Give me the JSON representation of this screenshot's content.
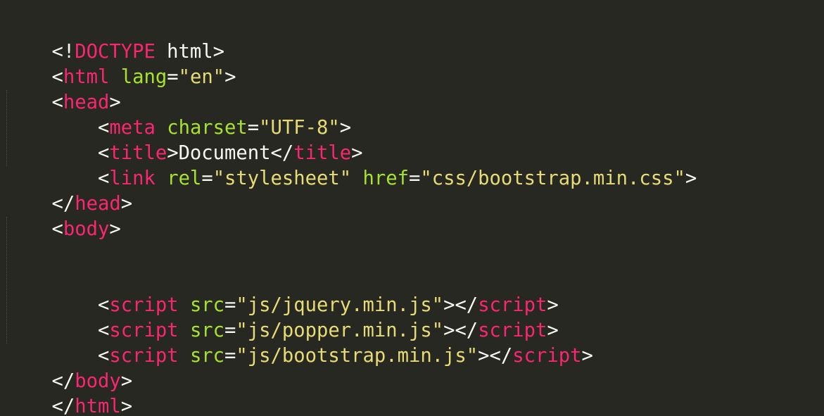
{
  "editor": {
    "language": "html",
    "theme_colors": {
      "background": "#272822",
      "tag": "#f92672",
      "attribute": "#a6e22e",
      "string": "#e6db74",
      "text": "#f8f8f2"
    },
    "lines": {
      "l1": {
        "open": "<!",
        "tag": "DOCTYPE",
        "text": " html",
        "close": ">"
      },
      "l2": {
        "open": "<",
        "tag": "html",
        "sp": " ",
        "attr": "lang",
        "eq": "=",
        "str": "\"en\"",
        "close": ">"
      },
      "l3": {
        "open": "<",
        "tag": "head",
        "close": ">"
      },
      "l4": {
        "indent": "    ",
        "open": "<",
        "tag": "meta",
        "sp": " ",
        "attr": "charset",
        "eq": "=",
        "str": "\"UTF-8\"",
        "close": ">"
      },
      "l5": {
        "indent": "    ",
        "open": "<",
        "tag": "title",
        "close": ">",
        "text": "Document",
        "open2": "</",
        "tag2": "title",
        "close2": ">"
      },
      "l6": {
        "indent": "    ",
        "open": "<",
        "tag": "link",
        "sp": " ",
        "attr": "rel",
        "eq": "=",
        "str": "\"stylesheet\"",
        "sp2": " ",
        "attr2": "href",
        "eq2": "=",
        "str2": "\"css/bootstrap.min.css\"",
        "close": ">"
      },
      "l7": {
        "open": "</",
        "tag": "head",
        "close": ">"
      },
      "l8": {
        "open": "<",
        "tag": "body",
        "close": ">"
      },
      "l11": {
        "indent": "    ",
        "open": "<",
        "tag": "script",
        "sp": " ",
        "attr": "src",
        "eq": "=",
        "str": "\"js/jquery.min.js\"",
        "close": ">",
        "open2": "</",
        "tag2": "script",
        "close2": ">"
      },
      "l12": {
        "indent": "    ",
        "open": "<",
        "tag": "script",
        "sp": " ",
        "attr": "src",
        "eq": "=",
        "str": "\"js/popper.min.js\"",
        "close": ">",
        "open2": "</",
        "tag2": "script",
        "close2": ">"
      },
      "l13": {
        "indent": "    ",
        "open": "<",
        "tag": "script",
        "sp": " ",
        "attr": "src",
        "eq": "=",
        "str": "\"js/bootstrap.min.js\"",
        "close": ">",
        "open2": "</",
        "tag2": "script",
        "close2": ">"
      },
      "l14": {
        "open": "</",
        "tag": "body",
        "close": ">"
      },
      "l15": {
        "open": "</",
        "tag": "html",
        "close": ">"
      }
    }
  }
}
